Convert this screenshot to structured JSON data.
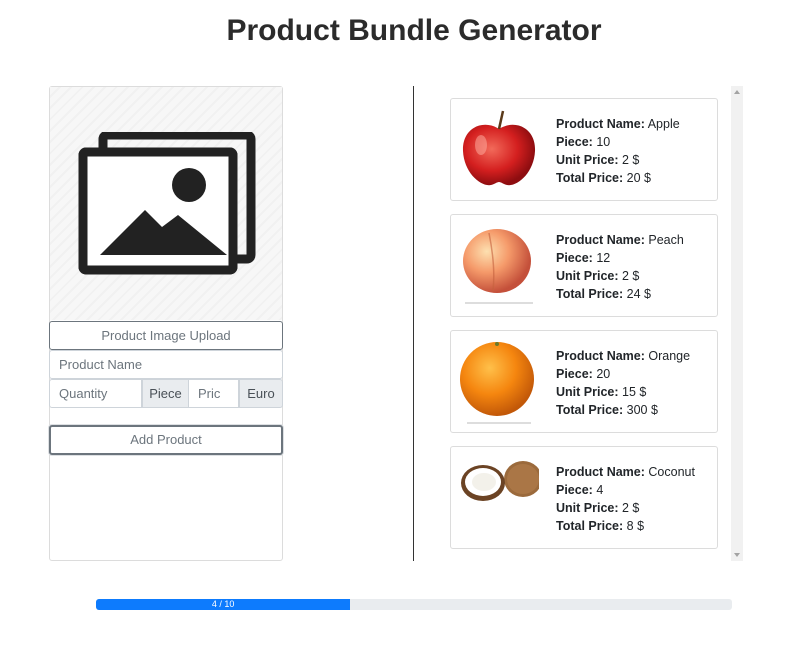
{
  "page": {
    "title": "Product Bundle Generator"
  },
  "form": {
    "image_icon": "image-placeholder-icon",
    "upload_label": "Product Image Upload",
    "name_placeholder": "Product Name",
    "quantity_placeholder": "Quantity",
    "quantity_unit": "Piece",
    "price_placeholder": "Pric",
    "price_unit": "Euro",
    "add_label": "Add Product"
  },
  "labels": {
    "name": "Product Name:",
    "piece": "Piece:",
    "unit_price": "Unit Price:",
    "total_price": "Total Price:"
  },
  "products": [
    {
      "name": "Apple",
      "piece": "10",
      "unit_price": "2 $",
      "total_price": "20 $",
      "image": "apple-image"
    },
    {
      "name": "Peach",
      "piece": "12",
      "unit_price": "2 $",
      "total_price": "24 $",
      "image": "peach-image"
    },
    {
      "name": "Orange",
      "piece": "20",
      "unit_price": "15 $",
      "total_price": "300 $",
      "image": "orange-image"
    },
    {
      "name": "Coconut",
      "piece": "4",
      "unit_price": "2 $",
      "total_price": "8 $",
      "image": "coconut-image"
    }
  ],
  "progress": {
    "label": "4 / 10",
    "current": 4,
    "total": 10,
    "fraction": 0.4
  },
  "colors": {
    "progress": "#0d7bfd",
    "text": "#212529",
    "muted": "#6c757d"
  }
}
